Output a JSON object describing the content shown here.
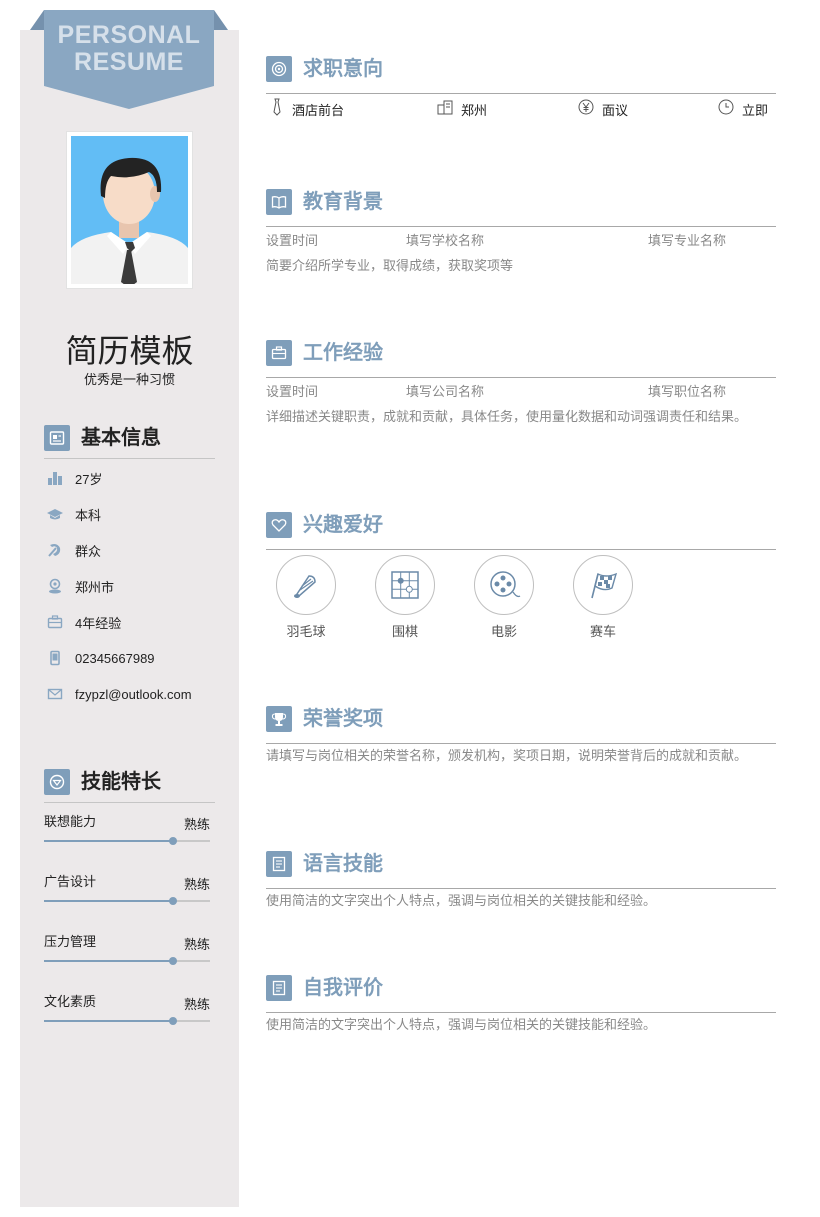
{
  "banner": {
    "line1": "PERSONAL",
    "line2": "RESUME"
  },
  "profile": {
    "name": "简历模板",
    "motto": "优秀是一种习惯"
  },
  "basic_info": {
    "title": "基本信息",
    "items": [
      {
        "icon": "chart-bar-icon",
        "text": "27岁"
      },
      {
        "icon": "graduation-cap-icon",
        "text": "本科"
      },
      {
        "icon": "party-emblem-icon",
        "text": "群众"
      },
      {
        "icon": "location-pin-icon",
        "text": "郑州市"
      },
      {
        "icon": "briefcase-icon",
        "text": "4年经验"
      },
      {
        "icon": "phone-icon",
        "text": "02345667989"
      },
      {
        "icon": "mail-icon",
        "text": "fzypzl@outlook.com"
      }
    ]
  },
  "skills": {
    "title": "技能特长",
    "items": [
      {
        "label": "联想能力",
        "level_text": "熟练",
        "level": 0.78
      },
      {
        "label": "广告设计",
        "level_text": "熟练",
        "level": 0.78
      },
      {
        "label": "压力管理",
        "level_text": "熟练",
        "level": 0.78
      },
      {
        "label": "文化素质",
        "level_text": "熟练",
        "level": 0.78
      }
    ]
  },
  "job_intent": {
    "title": "求职意向",
    "position": "酒店前台",
    "city": "郑州",
    "salary": "面议",
    "availability": "立即"
  },
  "education": {
    "title": "教育背景",
    "time": "设置时间",
    "school": "填写学校名称",
    "major": "填写专业名称",
    "desc": "简要介绍所学专业，取得成绩，获取奖项等"
  },
  "work": {
    "title": "工作经验",
    "time": "设置时间",
    "company": "填写公司名称",
    "role": "填写职位名称",
    "desc": "详细描述关键职责，成就和贡献，具体任务，使用量化数据和动词强调责任和结果。"
  },
  "hobbies": {
    "title": "兴趣爱好",
    "items": [
      {
        "icon": "badminton-icon",
        "label": "羽毛球"
      },
      {
        "icon": "go-board-icon",
        "label": "围棋"
      },
      {
        "icon": "film-reel-icon",
        "label": "电影"
      },
      {
        "icon": "racing-flag-icon",
        "label": "赛车"
      }
    ]
  },
  "honors": {
    "title": "荣誉奖项",
    "desc": "请填写与岗位相关的荣誉名称，颁发机构，奖项日期，说明荣誉背后的成就和贡献。"
  },
  "language": {
    "title": "语言技能",
    "desc": "使用简洁的文字突出个人特点，强调与岗位相关的关键技能和经验。"
  },
  "self_eval": {
    "title": "自我评价",
    "desc": "使用简洁的文字突出个人特点，强调与岗位相关的关键技能和经验。"
  },
  "colors": {
    "accent": "#7f9eba",
    "sidebar_bg": "#ece9ea",
    "banner": "#8aa7c2"
  }
}
